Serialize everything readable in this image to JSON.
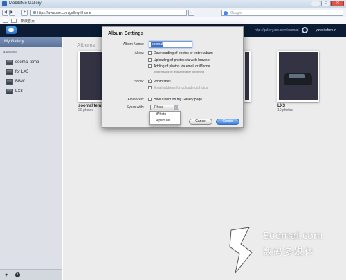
{
  "window": {
    "title": "MobileMe Gallery",
    "min": "–",
    "max": "□",
    "close": "✕"
  },
  "browser": {
    "back": "◀",
    "forward": "▶",
    "new_tab": "+",
    "go": "→",
    "url": "https://www.me.com/gallery/#home",
    "search_placeholder": "Google",
    "favorites_label": "新浪首页"
  },
  "appbar": {
    "gallery_url": "http://gallery.me.com/soomal",
    "user": "yuwei.chen ▾"
  },
  "sidebar": {
    "my_gallery": "My Gallery",
    "albums_header": "▾ Albums",
    "items": [
      {
        "label": "soomal temp"
      },
      {
        "label": "for LX3"
      },
      {
        "label": "BBW"
      },
      {
        "label": "LX3"
      }
    ],
    "add_button": "+",
    "info_button": "i"
  },
  "main": {
    "heading": "Albums",
    "albums": [
      {
        "name": "soomal temp",
        "count": "20 photos"
      },
      {
        "name": "LX3",
        "count": "10 photos"
      }
    ]
  },
  "dialog": {
    "title": "Album Settings",
    "album_name_label": "Album Name:",
    "album_name_value": "soomal",
    "allow_label": "Allow:",
    "allow_options": [
      {
        "label": "Downloading of photos or entire album",
        "checked": false
      },
      {
        "label": "Uploading of photos via web browser",
        "checked": false
      },
      {
        "label": "Adding of photos via email or iPhone",
        "checked": false
      }
    ],
    "allow_note": "Address will be available after publishing",
    "show_label": "Show:",
    "show_options": [
      {
        "label": "Photo titles",
        "checked": true
      },
      {
        "label": "Email address for uploading photos",
        "checked": false
      }
    ],
    "advanced_label": "Advanced:",
    "advanced_option": "Hide album on my Gallery page",
    "syncs_label": "Syncs with:",
    "syncs_value": "iPhoto",
    "syncs_options": [
      "iPhoto",
      "Aperture"
    ],
    "cancel": "Cancel",
    "create": "Create"
  },
  "watermark": {
    "line1": "Soomal.com",
    "line2": "数码多媒体"
  },
  "colors": {
    "accent": "#3d82e0",
    "appbar": "#0c1c34",
    "sidebar_header": "#6d86ab"
  }
}
